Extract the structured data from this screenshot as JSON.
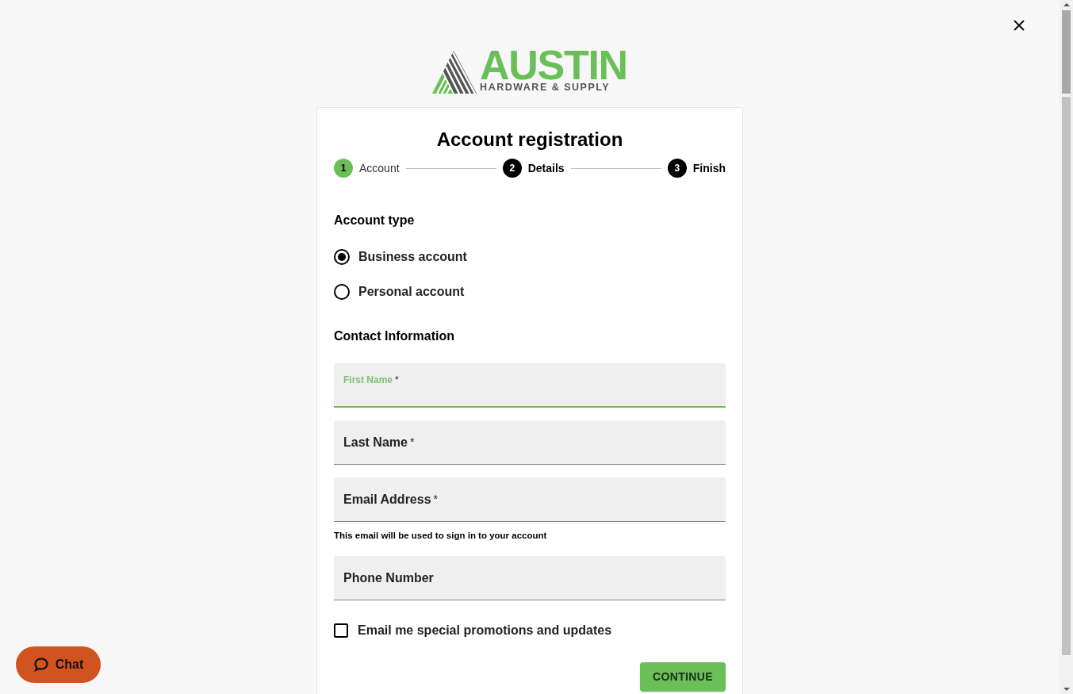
{
  "logo": {
    "name": "AUSTIN",
    "tagline": "HARDWARE & SUPPLY"
  },
  "title": "Account registration",
  "steps": [
    {
      "number": "1",
      "label": "Account",
      "selected": true
    },
    {
      "number": "2",
      "label": "Details",
      "selected": false
    },
    {
      "number": "3",
      "label": "Finish",
      "selected": false
    }
  ],
  "account_type": {
    "heading": "Account type",
    "options": [
      {
        "label": "Business account",
        "selected": true
      },
      {
        "label": "Personal account",
        "selected": false
      }
    ]
  },
  "contact": {
    "heading": "Contact Information",
    "fields": [
      {
        "label": "First Name",
        "marker": "*",
        "focused": true
      },
      {
        "label": "Last Name",
        "marker": "*",
        "focused": false
      },
      {
        "label": "Email Address",
        "marker": "*",
        "focused": false,
        "helper": "This email will be used to sign in to your account"
      },
      {
        "label": "Phone Number",
        "focused": false
      }
    ]
  },
  "promotions": {
    "label": "Email me special promotions and updates",
    "checked": false
  },
  "continue_button": "CONTINUE",
  "chat_button": "Chat"
}
